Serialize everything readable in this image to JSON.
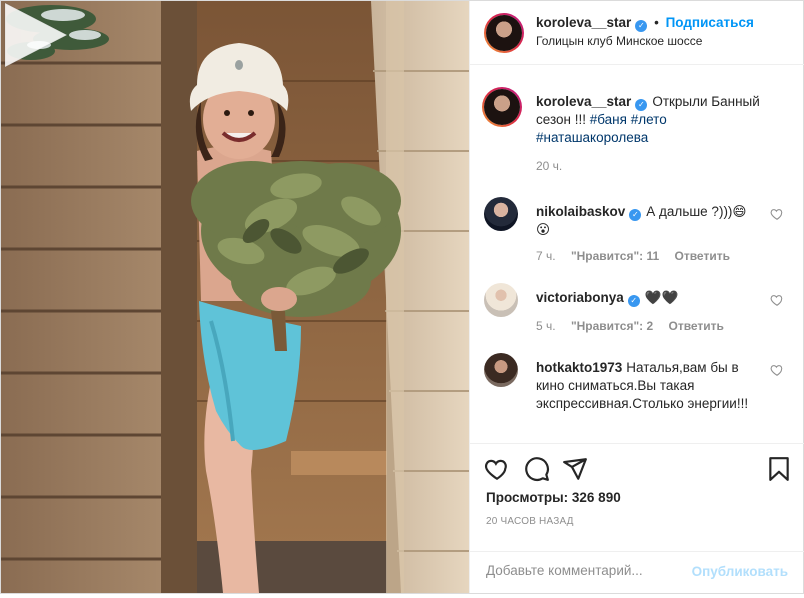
{
  "post": {
    "author": "koroleva__star",
    "verified": true,
    "follow_label": "Подписаться",
    "location": "Голицын клуб Минское шоссе"
  },
  "caption": {
    "author": "koroleva__star",
    "text": "Открыли Банный сезон !!!",
    "tags": [
      "#баня",
      "#лето",
      "#наташакоролева"
    ],
    "time": "20 ч."
  },
  "comments": [
    {
      "author": "nikolaibaskov",
      "verified": true,
      "text": "А дальше ?)))😄😮",
      "time": "7 ч.",
      "likes": "\"Нравится\": 11",
      "reply": "Ответить"
    },
    {
      "author": "victoriabonya",
      "verified": true,
      "text": "🖤🖤",
      "time": "5 ч.",
      "likes": "\"Нравится\": 2",
      "reply": "Ответить"
    },
    {
      "author": "hotkakto1973",
      "verified": false,
      "text": "Наталья,вам бы в кино сниматься.Вы такая экспрессивная.Столько энергии!!!",
      "time": "",
      "likes": "",
      "reply": ""
    }
  ],
  "stats": {
    "views_label": "Просмотры:",
    "views_value": "326 890",
    "ago": "20 ЧАСОВ НАЗАД"
  },
  "add_comment": {
    "placeholder": "Добавьте комментарий...",
    "publish_label": "Опубликовать"
  },
  "icons": [
    "play-icon",
    "heart-icon",
    "comment-icon",
    "share-icon",
    "bookmark-icon",
    "verified-icon"
  ],
  "colors": {
    "link": "#0095f6",
    "hashtag": "#00376b",
    "muted": "#8e8e8e",
    "publish_disabled": "#b2dffc"
  }
}
